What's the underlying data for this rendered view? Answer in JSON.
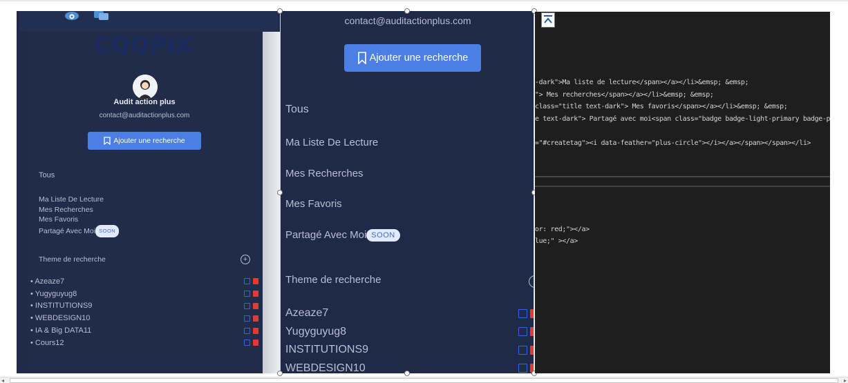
{
  "left": {
    "logo": "CQQPIX",
    "user_name": "Audit action plus",
    "email": "contact@auditactionplus.com",
    "add_button": "Ajouter une recherche",
    "tous": "Tous",
    "menu": [
      "Ma Liste De Lecture",
      "Mes Recherches",
      "Mes Favoris",
      "Partagé Avec Moi"
    ],
    "soon": "SOON",
    "theme_title": "Theme de recherche",
    "themes": [
      "Azeaze7",
      "Yugyguyug8",
      "INSTITUTIONS9",
      "WEBDESIGN10",
      "IA & Big DATA11",
      "Cours12"
    ]
  },
  "middle": {
    "email": "contact@auditactionplus.com",
    "add_button": "Ajouter une recherche",
    "tous": "Tous",
    "menu": [
      "Ma Liste De Lecture",
      "Mes Recherches",
      "Mes Favoris",
      "Partagé Avec Moi"
    ],
    "soon": "SOON",
    "theme_title": "Theme de recherche",
    "themes": [
      "Azeaze7",
      "Yugyguyug8",
      "INSTITUTIONS9",
      "WEBDESIGN10"
    ]
  },
  "code": {
    "lines": [
      "-dark\">Ma liste de lecture</span></a></li>&emsp; &emsp;",
      "\"> Mes recherches</span></a></li>&emsp; &emsp;",
      " class=\"title text-dark\"> Mes favoris</span></a></li>&emsp; &emsp;",
      "e text-dark\"> Partagé avec moi<span class=\"badge badge-light-primary badge-pill badge-roun",
      "=\"#createtag\"><i data-feather=\"plus-circle\"></i></a></span></span></li>",
      "or: red;\"></a>",
      "lue;\" ></a>"
    ]
  },
  "colors": {
    "panel_bg": "#1f2a48",
    "button_blue": "#4b7fe6",
    "edit_blue": "#2f66e8",
    "delete_red": "#e53838",
    "code_bg": "#1e1e1e"
  }
}
